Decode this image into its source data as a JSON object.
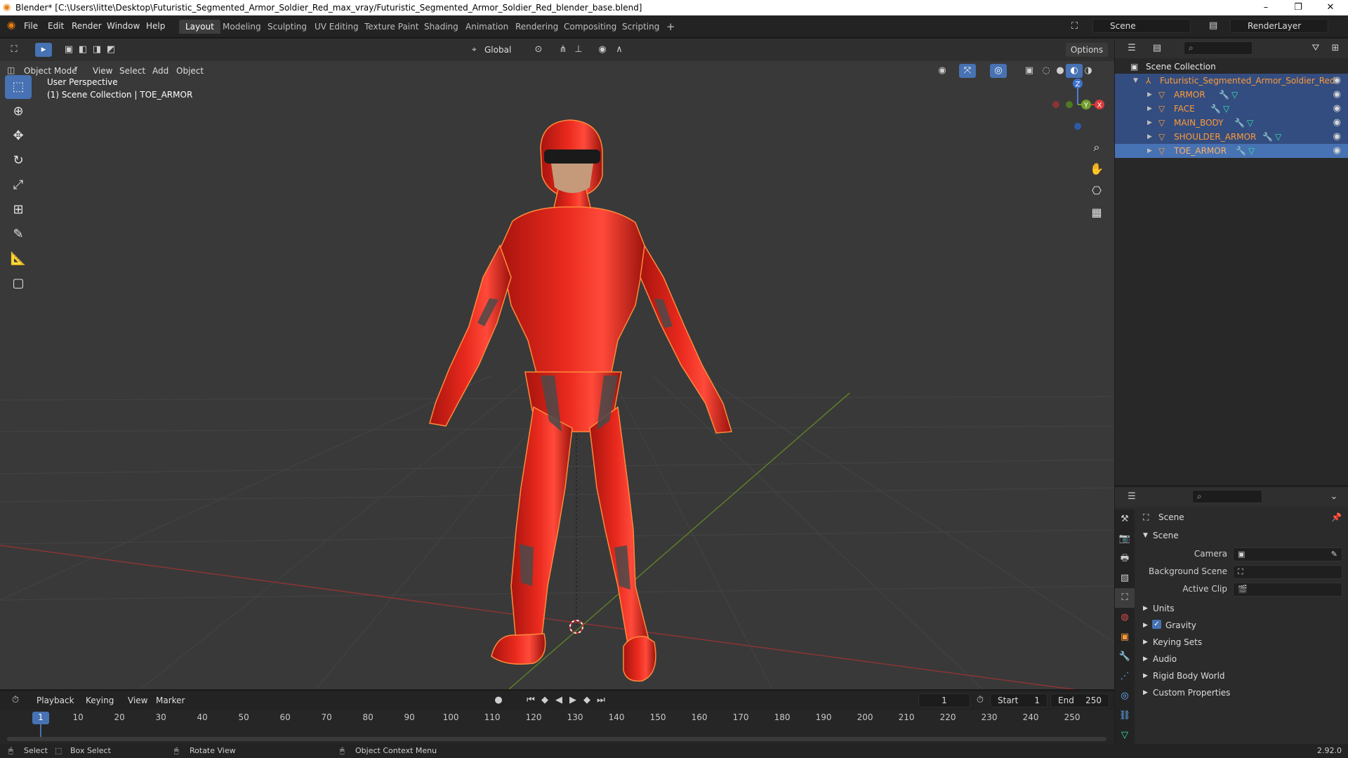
{
  "window": {
    "title": "Blender* [C:\\Users\\litte\\Desktop\\Futuristic_Segmented_Armor_Soldier_Red_max_vray/Futuristic_Segmented_Armor_Soldier_Red_blender_base.blend]",
    "minimize": "–",
    "maximize": "❐",
    "close": "✕"
  },
  "menu": [
    "File",
    "Edit",
    "Render",
    "Window",
    "Help"
  ],
  "workspaces": [
    "Layout",
    "Modeling",
    "Sculpting",
    "UV Editing",
    "Texture Paint",
    "Shading",
    "Animation",
    "Rendering",
    "Compositing",
    "Scripting"
  ],
  "workspace_add": "+",
  "scene_field": "Scene",
  "renderlayer_field": "RenderLayer",
  "viewport": {
    "mode": "Object Mode",
    "menus": [
      "View",
      "Select",
      "Add",
      "Object"
    ],
    "orientation": "Global",
    "options": "Options",
    "overlay_title": "User Perspective",
    "overlay_sub": "(1) Scene Collection | TOE_ARMOR",
    "gizmo": {
      "z": "Z",
      "x": "X",
      "y": "Y"
    }
  },
  "outliner": {
    "root": "Scene Collection",
    "collection": "Futuristic_Segmented_Armor_Soldier_Red",
    "objects": [
      "ARMOR",
      "FACE",
      "MAIN_BODY",
      "SHOULDER_ARMOR",
      "TOE_ARMOR"
    ],
    "selected": "TOE_ARMOR"
  },
  "properties": {
    "header": "Scene",
    "panel": "Scene",
    "fields": [
      {
        "label": "Camera",
        "value": ""
      },
      {
        "label": "Background Scene",
        "value": ""
      },
      {
        "label": "Active Clip",
        "value": ""
      }
    ],
    "subpanels": [
      "Units",
      "Gravity",
      "Keying Sets",
      "Audio",
      "Rigid Body World",
      "Custom Properties"
    ],
    "gravity_checked": true
  },
  "timeline": {
    "menus": [
      "Playback",
      "Keying",
      "View",
      "Marker"
    ],
    "current_frame": "1",
    "start_label": "Start",
    "start": "1",
    "end_label": "End",
    "end": "250",
    "ticks": [
      "1",
      "10",
      "20",
      "30",
      "40",
      "50",
      "60",
      "70",
      "80",
      "90",
      "100",
      "110",
      "120",
      "130",
      "140",
      "150",
      "160",
      "170",
      "180",
      "190",
      "200",
      "210",
      "220",
      "230",
      "240",
      "250"
    ]
  },
  "statusbar": {
    "select": "Select",
    "box_select": "Box Select",
    "rotate_view": "Rotate View",
    "context_menu": "Object Context Menu",
    "version": "2.92.0"
  },
  "colors": {
    "accent": "#4772b3",
    "object_orange": "#ff9a37",
    "selection_row": "#334d80",
    "armor_red": "#e0231a",
    "viewport_bg": "#393939"
  }
}
